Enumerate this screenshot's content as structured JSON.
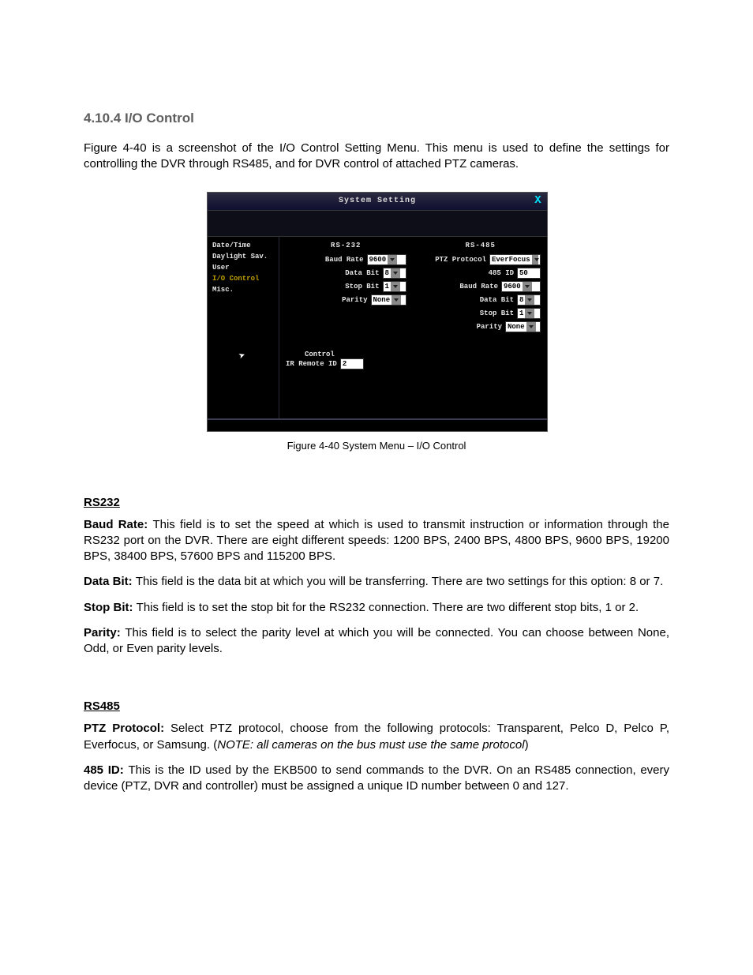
{
  "headings": {
    "section": "4.10.4 I/O Control",
    "rs232": "RS232",
    "rs485": "RS485"
  },
  "intro": "Figure 4-40 is a screenshot of the I/O Control Setting Menu. This menu is used to define the settings for controlling the DVR through RS485, and for DVR control of attached PTZ cameras.",
  "screenshot": {
    "title": "System Setting",
    "close": "X",
    "sidebar": [
      "Date/Time",
      "Daylight Sav.",
      "User",
      "I/O Control",
      "Misc."
    ],
    "rs232": {
      "title": "RS-232",
      "baud_rate_lbl": "Baud Rate",
      "baud_rate_val": "9600",
      "data_bit_lbl": "Data Bit",
      "data_bit_val": "8",
      "stop_bit_lbl": "Stop Bit",
      "stop_bit_val": "1",
      "parity_lbl": "Parity",
      "parity_val": "None"
    },
    "rs485": {
      "title": "RS-485",
      "ptz_protocol_lbl": "PTZ Protocol",
      "ptz_protocol_val": "EverFocus",
      "id_lbl": "485 ID",
      "id_val": "50",
      "baud_rate_lbl": "Baud Rate",
      "baud_rate_val": "9600",
      "data_bit_lbl": "Data Bit",
      "data_bit_val": "8",
      "stop_bit_lbl": "Stop Bit",
      "stop_bit_val": "1",
      "parity_lbl": "Parity",
      "parity_val": "None"
    },
    "control": {
      "title": "Control",
      "ir_lbl": "IR Remote ID",
      "ir_val": "2"
    }
  },
  "figure_caption": "Figure 4-40 System Menu – I/O Control",
  "rs232_text": {
    "baud_label": "Baud Rate: ",
    "baud": "This field is to set the speed at which is used to transmit instruction or information through the RS232 port on the DVR. There are eight different speeds: 1200 BPS, 2400 BPS, 4800 BPS, 9600 BPS, 19200 BPS, 38400 BPS, 57600 BPS and 115200 BPS.",
    "data_label": "Data Bit: ",
    "data": "This field is the data bit at which you will be transferring. There are two settings for this option: 8 or 7.",
    "stop_label": "Stop Bit: ",
    "stop": "This field is to set the stop bit for the RS232 connection. There are two different stop bits, 1 or 2.",
    "parity_label": "Parity: ",
    "parity": "This field is to select the parity level at which you will be connected. You can choose between None, Odd, or Even parity levels."
  },
  "rs485_text": {
    "ptz_label": "PTZ Protocol: ",
    "ptz_a": "Select PTZ protocol, choose from the following protocols: Transparent, Pelco D, Pelco P, Everfocus, or Samsung. (",
    "ptz_note": "NOTE: all cameras on the bus must use the same protocol",
    "ptz_b": ")",
    "id_label": "485 ID: ",
    "id": "This is the ID used by the EKB500 to send commands to the DVR. On an RS485 connection, every device (PTZ, DVR and controller) must be assigned a unique ID number between 0 and 127."
  }
}
